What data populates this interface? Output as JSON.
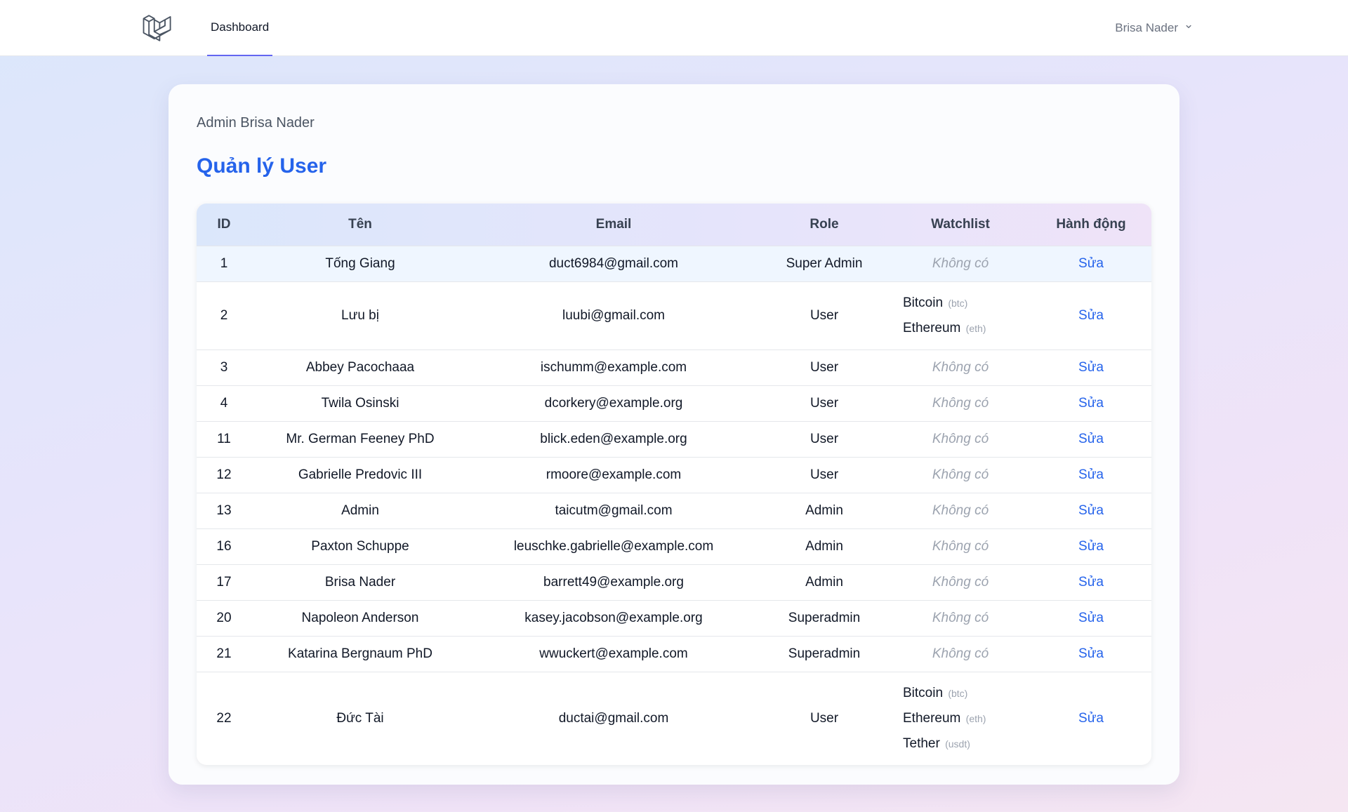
{
  "nav": {
    "logo_icon": "laravel-logo-icon",
    "dashboard_label": "Dashboard",
    "user_name": "Brisa Nader"
  },
  "main": {
    "admin_label": "Admin Brisa Nader",
    "title": "Quản lý User"
  },
  "table": {
    "headers": [
      "ID",
      "Tên",
      "Email",
      "Role",
      "Watchlist",
      "Hành động"
    ],
    "empty_watchlist": "Không có",
    "action_label": "Sửa",
    "rows": [
      {
        "id": "1",
        "name": "Tống Giang",
        "email": "duct6984@gmail.com",
        "role": "Super Admin",
        "watchlist": []
      },
      {
        "id": "2",
        "name": "Lưu bị",
        "email": "luubi@gmail.com",
        "role": "User",
        "watchlist": [
          {
            "name": "Bitcoin",
            "symbol": "(btc)"
          },
          {
            "name": "Ethereum",
            "symbol": "(eth)"
          }
        ]
      },
      {
        "id": "3",
        "name": "Abbey Pacochaaa",
        "email": "ischumm@example.com",
        "role": "User",
        "watchlist": []
      },
      {
        "id": "4",
        "name": "Twila Osinski",
        "email": "dcorkery@example.org",
        "role": "User",
        "watchlist": []
      },
      {
        "id": "11",
        "name": "Mr. German Feeney PhD",
        "email": "blick.eden@example.org",
        "role": "User",
        "watchlist": []
      },
      {
        "id": "12",
        "name": "Gabrielle Predovic III",
        "email": "rmoore@example.com",
        "role": "User",
        "watchlist": []
      },
      {
        "id": "13",
        "name": "Admin",
        "email": "taicutm@gmail.com",
        "role": "Admin",
        "watchlist": []
      },
      {
        "id": "16",
        "name": "Paxton Schuppe",
        "email": "leuschke.gabrielle@example.com",
        "role": "Admin",
        "watchlist": []
      },
      {
        "id": "17",
        "name": "Brisa Nader",
        "email": "barrett49@example.org",
        "role": "Admin",
        "watchlist": []
      },
      {
        "id": "20",
        "name": "Napoleon Anderson",
        "email": "kasey.jacobson@example.org",
        "role": "Superadmin",
        "watchlist": []
      },
      {
        "id": "21",
        "name": "Katarina Bergnaum PhD",
        "email": "wwuckert@example.com",
        "role": "Superadmin",
        "watchlist": []
      },
      {
        "id": "22",
        "name": "Đức Tài",
        "email": "ductai@gmail.com",
        "role": "User",
        "watchlist": [
          {
            "name": "Bitcoin",
            "symbol": "(btc)"
          },
          {
            "name": "Ethereum",
            "symbol": "(eth)"
          },
          {
            "name": "Tether",
            "symbol": "(usdt)"
          }
        ]
      }
    ]
  },
  "colors": {
    "accent": "#2563eb",
    "nav_indicator": "#6366f1",
    "muted": "#9ca3af"
  }
}
